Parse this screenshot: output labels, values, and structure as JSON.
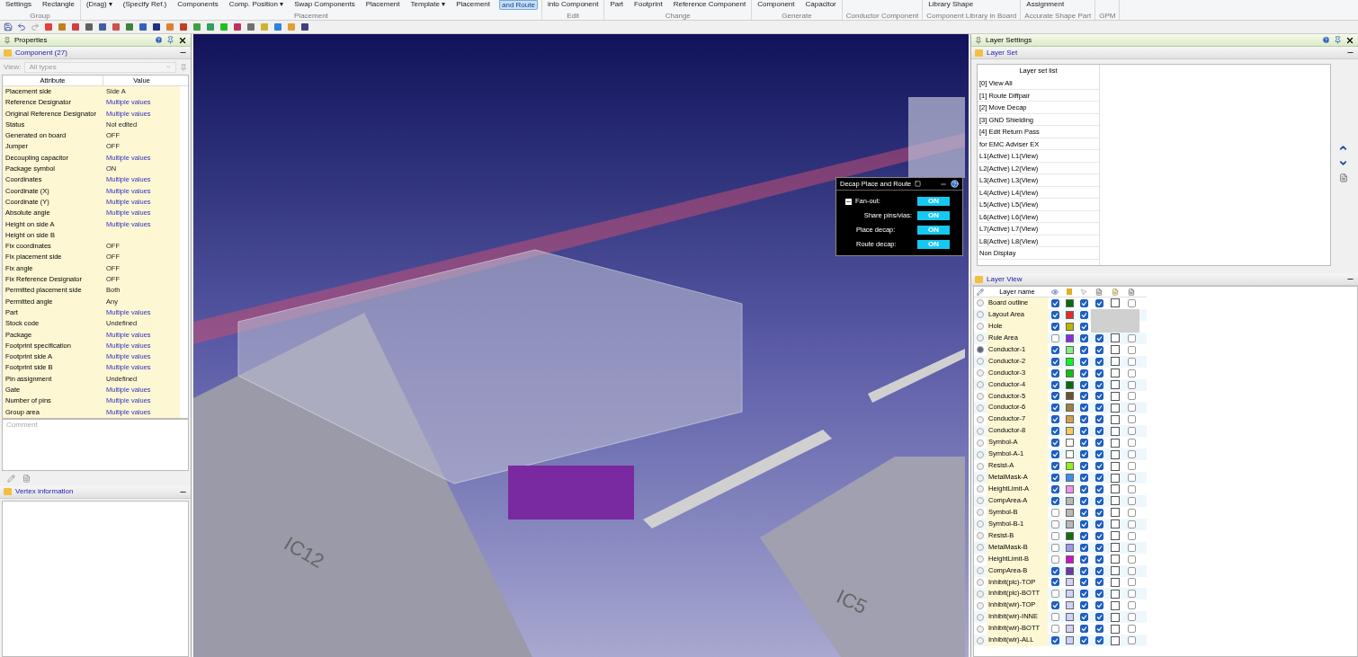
{
  "ribbon": {
    "groups": [
      {
        "label": "Group",
        "buttons": [
          {
            "lines": [
              "Settings"
            ],
            "selected": false
          },
          {
            "lines": [
              "Rectangle"
            ],
            "selected": false
          }
        ]
      },
      {
        "label": "Placement",
        "buttons": [
          {
            "lines": [
              "(Drag) ▾"
            ],
            "selected": false
          },
          {
            "lines": [
              "(Specify Ref.)"
            ],
            "selected": false
          },
          {
            "lines": [
              "Components"
            ],
            "selected": false
          },
          {
            "lines": [
              "Comp. Position ▾"
            ],
            "selected": false
          },
          {
            "lines": [
              "Swap Components"
            ],
            "selected": false
          },
          {
            "lines": [
              "Placement"
            ],
            "selected": false
          },
          {
            "lines": [
              "Template ▾"
            ],
            "selected": false
          },
          {
            "lines": [
              "Placement"
            ],
            "selected": false
          },
          {
            "lines": [
              "and Route"
            ],
            "selected": true
          }
        ]
      },
      {
        "label": "Edit",
        "buttons": [
          {
            "lines": [
              "into Component"
            ],
            "selected": false
          }
        ]
      },
      {
        "label": "Change",
        "buttons": [
          {
            "lines": [
              "Part"
            ],
            "selected": false
          },
          {
            "lines": [
              "Footprint"
            ],
            "selected": false
          },
          {
            "lines": [
              "Reference Component"
            ],
            "selected": false
          }
        ]
      },
      {
        "label": "Generate",
        "buttons": [
          {
            "lines": [
              "Component"
            ],
            "selected": false
          },
          {
            "lines": [
              "Capacitor"
            ],
            "selected": false
          }
        ]
      },
      {
        "label": "Conductor Component"
      },
      {
        "label": "Component Library in Board",
        "buttons": [
          {
            "lines": [
              "Library Shape"
            ],
            "selected": false
          }
        ]
      },
      {
        "label": "Accurate Shape Part",
        "buttons": [
          {
            "lines": [
              "Assignment"
            ],
            "selected": false
          }
        ]
      },
      {
        "label": "GPM"
      }
    ]
  },
  "properties": {
    "title": "Properties",
    "section": "Component (27)",
    "view_label": "View:",
    "view_value": "All types",
    "columns": [
      "Attribute",
      "Value"
    ],
    "rows": [
      {
        "attribute": "Placement side",
        "value": "Side A",
        "kind": "plain"
      },
      {
        "attribute": "Reference Designator",
        "value": "Multiple values",
        "kind": "multiple"
      },
      {
        "attribute": "Original Reference Designator",
        "value": "Multiple values",
        "kind": "multiple"
      },
      {
        "attribute": "Status",
        "value": "Not edited",
        "kind": "plain"
      },
      {
        "attribute": "Generated on board",
        "value": "OFF",
        "kind": "plain"
      },
      {
        "attribute": "Jumper",
        "value": "OFF",
        "kind": "plain"
      },
      {
        "attribute": "Decoupling capacitor",
        "value": "Multiple values",
        "kind": "multiple"
      },
      {
        "attribute": "Package symbol",
        "value": "ON",
        "kind": "plain"
      },
      {
        "attribute": "Coordinates",
        "value": "Multiple values",
        "kind": "multiple"
      },
      {
        "attribute": "Coordinate (X)",
        "value": "Multiple values",
        "kind": "multiple"
      },
      {
        "attribute": "Coordinate (Y)",
        "value": "Multiple values",
        "kind": "multiple"
      },
      {
        "attribute": "Absolute angle",
        "value": "Multiple values",
        "kind": "multiple"
      },
      {
        "attribute": "Height on side A",
        "value": "Multiple values",
        "kind": "multiple"
      },
      {
        "attribute": "Height on side B",
        "value": "",
        "kind": "plain"
      },
      {
        "attribute": "Fix coordinates",
        "value": "OFF",
        "kind": "plain"
      },
      {
        "attribute": "Fix placement side",
        "value": "OFF",
        "kind": "plain"
      },
      {
        "attribute": "Fix angle",
        "value": "OFF",
        "kind": "plain"
      },
      {
        "attribute": "Fix Reference Designator",
        "value": "OFF",
        "kind": "plain"
      },
      {
        "attribute": "Permitted placement side",
        "value": "Both",
        "kind": "plain"
      },
      {
        "attribute": "Permitted angle",
        "value": "Any",
        "kind": "plain"
      },
      {
        "attribute": "Part",
        "value": "Multiple values",
        "kind": "multiple"
      },
      {
        "attribute": "Stock code",
        "value": "Undefined",
        "kind": "plain"
      },
      {
        "attribute": "Package",
        "value": "Multiple values",
        "kind": "multiple"
      },
      {
        "attribute": "Footprint specification",
        "value": "Multiple values",
        "kind": "multiple"
      },
      {
        "attribute": "Footprint side A",
        "value": "Multiple values",
        "kind": "multiple"
      },
      {
        "attribute": "Footprint side B",
        "value": "Multiple values",
        "kind": "multiple"
      },
      {
        "attribute": "Pin assignment",
        "value": "Undefined",
        "kind": "plain"
      },
      {
        "attribute": "Gate",
        "value": "Multiple values",
        "kind": "multiple"
      },
      {
        "attribute": "Number of pins",
        "value": "Multiple values",
        "kind": "multiple"
      },
      {
        "attribute": "Group area",
        "value": "Multiple values",
        "kind": "multiple"
      }
    ],
    "comment_placeholder": "Comment",
    "vertex_title": "Vertex information"
  },
  "viewport": {
    "labels": [
      "IC12",
      "IC5"
    ]
  },
  "decap_panel": {
    "title": "Decap Place and Route",
    "options": [
      {
        "label": "Fan-out:",
        "value": "ON",
        "on": true,
        "kind": "group",
        "expanded": true
      },
      {
        "label": "Share pins/vias:",
        "value": "ON",
        "on": true,
        "kind": "sub"
      },
      {
        "label": "Place decap:",
        "value": "ON",
        "on": true,
        "kind": "item"
      },
      {
        "label": "Route decap:",
        "value": "ON",
        "on": true,
        "kind": "item"
      }
    ]
  },
  "layer_settings": {
    "title": "Layer Settings",
    "set_title": "Layer Set",
    "set_header": "Layer set list",
    "sets": [
      "[0] View All",
      "[1] Route Diffpair",
      "[2] Move Decap",
      "[3] GND Shielding",
      "[4] Edit Return Pass",
      "for EMC Adviser EX",
      "L1(Active) L1(View)",
      "L2(Active) L2(View)",
      "L3(Active) L3(View)",
      "L4(Active) L4(View)",
      "L5(Active) L5(View)",
      "L6(Active) L6(View)",
      "L7(Active) L7(View)",
      "L8(Active) L8(View)",
      "Non Display"
    ],
    "view_title": "Layer View",
    "name_header": "Layer name",
    "layers": [
      {
        "name": "Board outline",
        "selected": false,
        "visible": true,
        "color": "#0a6b0a",
        "checks": [
          true,
          true,
          false,
          false
        ]
      },
      {
        "name": "Layout Area",
        "selected": false,
        "visible": true,
        "color": "#e82828",
        "checks": [
          true
        ]
      },
      {
        "name": "Hole",
        "selected": false,
        "visible": true,
        "color": "#b8b800",
        "checks": [
          true
        ]
      },
      {
        "name": "Rule Area",
        "selected": false,
        "visible": false,
        "color": "#8a2be2",
        "checks": [
          true,
          true,
          false,
          false
        ]
      },
      {
        "name": "Conductor-1",
        "selected": true,
        "visible": true,
        "color": "#80f080",
        "checks": [
          true,
          true,
          false,
          false
        ]
      },
      {
        "name": "Conductor-2",
        "selected": false,
        "visible": true,
        "color": "#00ff20",
        "checks": [
          true,
          true,
          false,
          false
        ]
      },
      {
        "name": "Conductor-3",
        "selected": false,
        "visible": true,
        "color": "#10c010",
        "checks": [
          true,
          true,
          false,
          false
        ]
      },
      {
        "name": "Conductor-4",
        "selected": false,
        "visible": true,
        "color": "#0a6a0a",
        "checks": [
          true,
          true,
          false,
          false
        ]
      },
      {
        "name": "Conductor-5",
        "selected": false,
        "visible": true,
        "color": "#6a5530",
        "checks": [
          true,
          true,
          false,
          false
        ]
      },
      {
        "name": "Conductor-6",
        "selected": false,
        "visible": true,
        "color": "#a08040",
        "checks": [
          true,
          true,
          false,
          false
        ]
      },
      {
        "name": "Conductor-7",
        "selected": false,
        "visible": true,
        "color": "#d0a050",
        "checks": [
          true,
          true,
          false,
          false
        ]
      },
      {
        "name": "Conductor-8",
        "selected": false,
        "visible": true,
        "color": "#f8c860",
        "checks": [
          true,
          true,
          false,
          false
        ]
      },
      {
        "name": "Symbol-A",
        "selected": false,
        "visible": true,
        "color": "#ffffff",
        "checks": [
          true,
          true,
          false,
          false
        ]
      },
      {
        "name": "Symbol-A-1",
        "selected": false,
        "visible": true,
        "color": "#fffffe",
        "checks": [
          true,
          true,
          false,
          false
        ]
      },
      {
        "name": "Resist-A",
        "selected": false,
        "visible": true,
        "color": "#90f020",
        "checks": [
          true,
          true,
          false,
          false
        ]
      },
      {
        "name": "MetalMask-A",
        "selected": false,
        "visible": true,
        "color": "#3a90f0",
        "checks": [
          true,
          true,
          false,
          false
        ]
      },
      {
        "name": "HeightLimit-A",
        "selected": false,
        "visible": true,
        "color": "#f090f0",
        "checks": [
          true,
          true,
          false,
          false
        ]
      },
      {
        "name": "CompArea-A",
        "selected": false,
        "visible": true,
        "color": "#b8b8b8",
        "checks": [
          true,
          true,
          false,
          false
        ]
      },
      {
        "name": "Symbol-B",
        "selected": false,
        "visible": false,
        "color": "#b8b8b9",
        "checks": [
          true,
          true,
          false,
          false
        ]
      },
      {
        "name": "Symbol-B-1",
        "selected": false,
        "visible": false,
        "color": "#b9b8b8",
        "checks": [
          true,
          true,
          false,
          false
        ]
      },
      {
        "name": "Resist-B",
        "selected": false,
        "visible": false,
        "color": "#107010",
        "checks": [
          true,
          true,
          false,
          false
        ]
      },
      {
        "name": "MetalMask-B",
        "selected": false,
        "visible": false,
        "color": "#9a9af0",
        "checks": [
          true,
          true,
          false,
          false
        ]
      },
      {
        "name": "HeightLimit-B",
        "selected": false,
        "visible": false,
        "color": "#d010d0",
        "checks": [
          true,
          true,
          false,
          false
        ]
      },
      {
        "name": "CompArea-B",
        "selected": false,
        "visible": true,
        "color": "#6a3aa0",
        "checks": [
          true,
          true,
          false,
          false
        ]
      },
      {
        "name": "Inhibit(plc)-TOP",
        "selected": false,
        "visible": true,
        "color": "#d0d0f8",
        "checks": [
          true,
          true,
          false,
          false
        ]
      },
      {
        "name": "Inhibit(plc)-BOTT",
        "selected": false,
        "visible": false,
        "color": "#d0d0f9",
        "checks": [
          true,
          true,
          false,
          false
        ]
      },
      {
        "name": "Inhibit(wir)-TOP",
        "selected": false,
        "visible": true,
        "color": "#d0d1f8",
        "checks": [
          true,
          true,
          false,
          false
        ]
      },
      {
        "name": "Inhibit(wir)-INNE",
        "selected": false,
        "visible": false,
        "color": "#d1d0f8",
        "checks": [
          true,
          true,
          false,
          false
        ]
      },
      {
        "name": "Inhibit(wir)-BOTT",
        "selected": false,
        "visible": false,
        "color": "#d0d0f7",
        "checks": [
          true,
          true,
          false,
          false
        ]
      },
      {
        "name": "Inhibit(wir)-ALL",
        "selected": false,
        "visible": true,
        "color": "#cfd0f8",
        "checks": [
          true,
          true,
          false,
          false
        ]
      }
    ]
  }
}
